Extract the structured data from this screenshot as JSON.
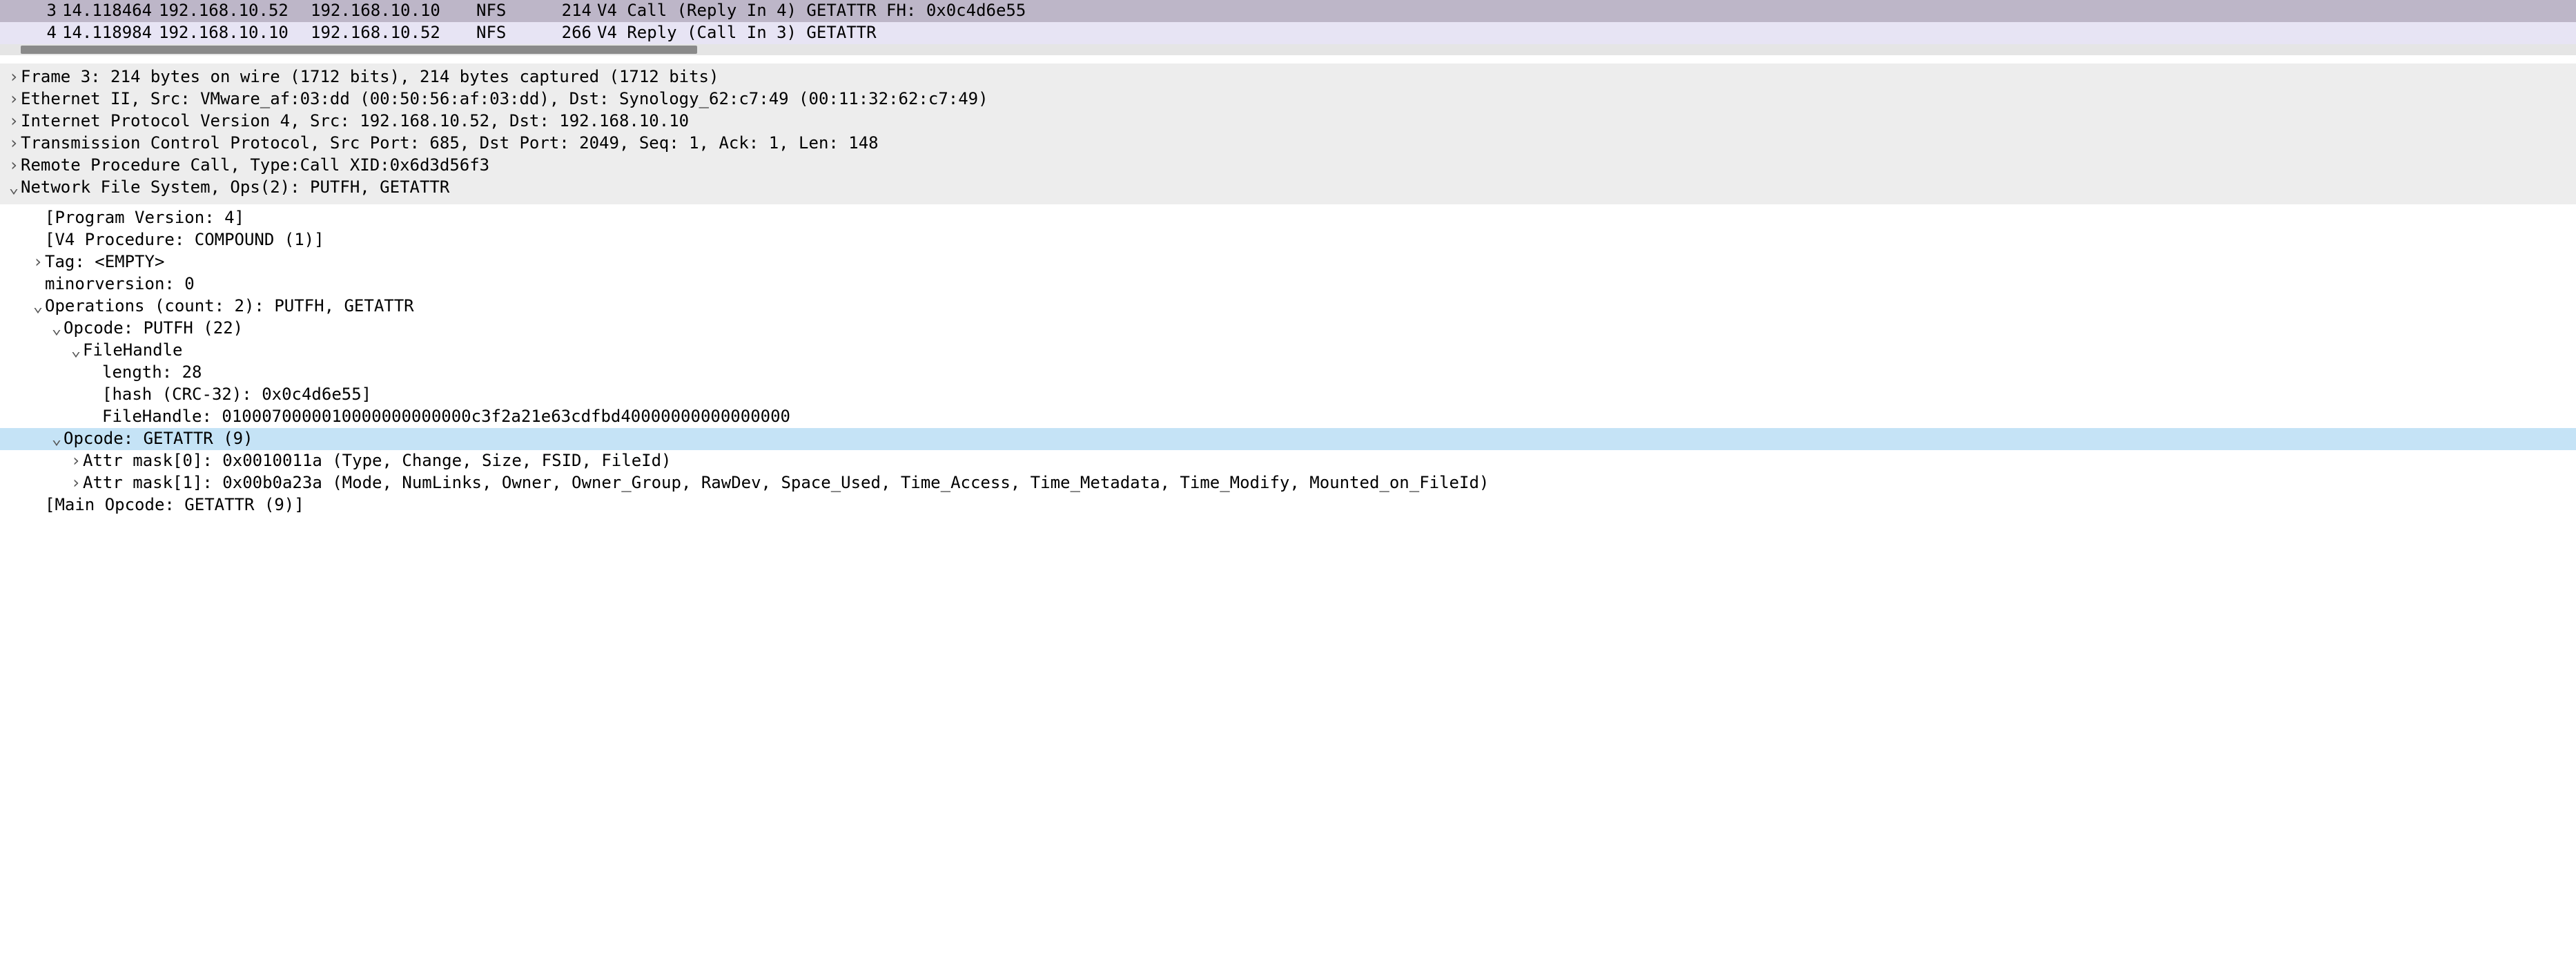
{
  "packets": [
    {
      "no": "3",
      "time": "14.118464",
      "src": "192.168.10.52",
      "dst": "192.168.10.10",
      "proto": "NFS",
      "len": "214",
      "info": "V4 Call (Reply In 4) GETATTR FH: 0x0c4d6e55",
      "sel": true
    },
    {
      "no": "4",
      "time": "14.118984",
      "src": "192.168.10.10",
      "dst": "192.168.10.52",
      "proto": "NFS",
      "len": "266",
      "info": "V4 Reply (Call In 3) GETATTR",
      "sel": false
    }
  ],
  "d": {
    "frame": "Frame 3: 214 bytes on wire (1712 bits), 214 bytes captured (1712 bits)",
    "eth": "Ethernet II, Src: VMware_af:03:dd (00:50:56:af:03:dd), Dst: Synology_62:c7:49 (00:11:32:62:c7:49)",
    "ip": "Internet Protocol Version 4, Src: 192.168.10.52, Dst: 192.168.10.10",
    "tcp": "Transmission Control Protocol, Src Port: 685, Dst Port: 2049, Seq: 1, Ack: 1, Len: 148",
    "rpc": "Remote Procedure Call, Type:Call XID:0x6d3d56f3",
    "nfs": "Network File System, Ops(2): PUTFH, GETATTR",
    "progver": "[Program Version: 4]",
    "v4proc": "[V4 Procedure: COMPOUND (1)]",
    "tag": "Tag: <EMPTY>",
    "minor": "minorversion: 0",
    "ops": "Operations (count: 2): PUTFH, GETATTR",
    "op_putfh": "Opcode: PUTFH (22)",
    "fh": "FileHandle",
    "fh_len": "length: 28",
    "fh_hash": "[hash (CRC-32): 0x0c4d6e55]",
    "fh_val": "FileHandle: 0100070000010000000000000c3f2a21e63cdfbd40000000000000000",
    "op_getattr": "Opcode: GETATTR (9)",
    "mask0": "Attr mask[0]: 0x0010011a (Type, Change, Size, FSID, FileId)",
    "mask1": "Attr mask[1]: 0x00b0a23a (Mode, NumLinks, Owner, Owner_Group, RawDev, Space_Used, Time_Access, Time_Metadata, Time_Modify, Mounted_on_FileId)",
    "mainop": "[Main Opcode: GETATTR (9)]"
  },
  "glyph": {
    "closed": "›",
    "open": "⌄"
  }
}
